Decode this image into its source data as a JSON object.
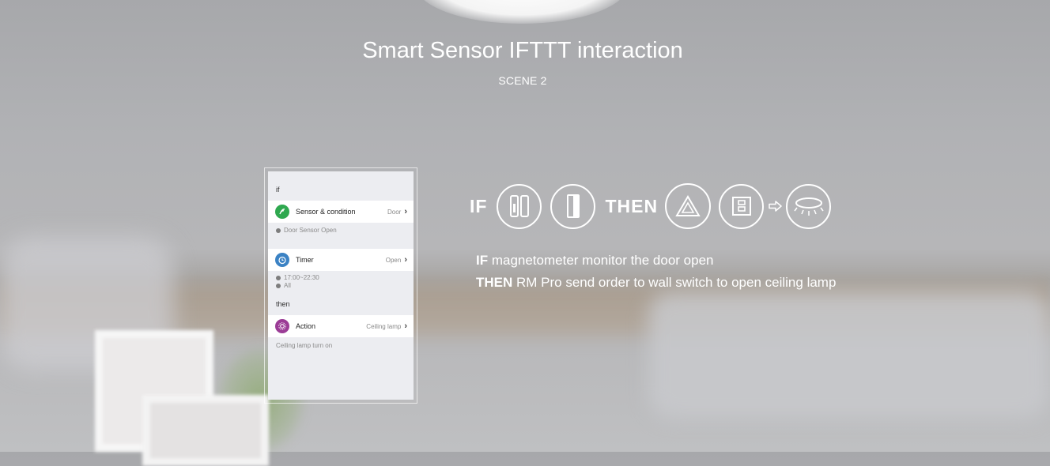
{
  "header": {
    "title": "Smart Sensor IFTTT interaction",
    "subtitle": "SCENE 2"
  },
  "phone": {
    "if_label": "if",
    "then_label": "then",
    "rows": [
      {
        "label": "Sensor & condition",
        "value": "Door",
        "icon": "sensor-icon",
        "color": "#2fa84f"
      },
      {
        "label": "Timer",
        "value": "Open",
        "icon": "alarm-clock-icon",
        "color": "#3b82c4"
      },
      {
        "label": "Action",
        "value": "Ceiling lamp",
        "icon": "action-icon",
        "color": "#9b3c96"
      }
    ],
    "notes": {
      "sensor": "Door Sensor Open",
      "timer_time": "17:00~22:30",
      "timer_repeat": "All",
      "action": "Ceiling lamp turn on"
    }
  },
  "flow": {
    "if_word": "IF",
    "then_word": "THEN",
    "icons": [
      "door-sensor-icon",
      "magnet-icon",
      "rm-pro-icon",
      "wall-switch-icon",
      "arrow-right-icon",
      "ceiling-lamp-icon"
    ]
  },
  "description": {
    "line1_keyword": "IF",
    "line1_text": " magnetometer monitor the door open",
    "line2_keyword": "THEN",
    "line2_text": " RM Pro send order to wall switch to open ceiling lamp"
  }
}
